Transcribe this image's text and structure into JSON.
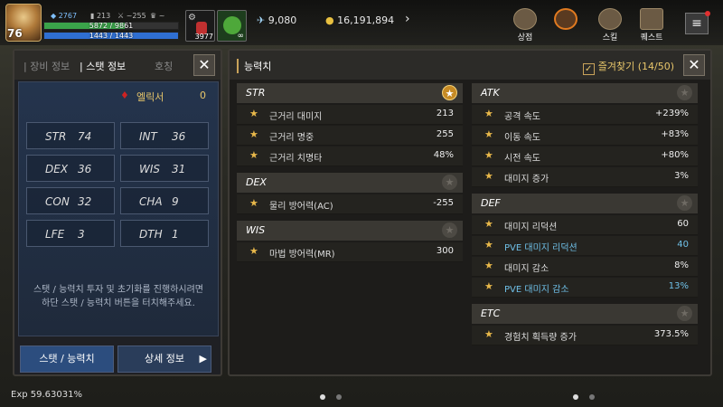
{
  "hud": {
    "level": "76",
    "gems": "2767",
    "stat1": "213",
    "stat2": "~255",
    "hp": "5872 / 9861",
    "mp": "1443 / 1443",
    "slot_count": "3977",
    "energy": "9,080",
    "gold": "16,191,894",
    "menu": [
      {
        "label": "상점"
      },
      {
        "label": ""
      },
      {
        "label": "스킬"
      },
      {
        "label": "퀘스트"
      }
    ]
  },
  "left": {
    "tabs": [
      "장비 정보",
      "스탯 정보",
      "호칭"
    ],
    "elixir_label": "엘릭서",
    "elixir_value": "0",
    "stats": [
      {
        "k": "STR",
        "v": "74"
      },
      {
        "k": "INT",
        "v": "36"
      },
      {
        "k": "DEX",
        "v": "36"
      },
      {
        "k": "WIS",
        "v": "31"
      },
      {
        "k": "CON",
        "v": "32"
      },
      {
        "k": "CHA",
        "v": "9"
      },
      {
        "k": "LFE",
        "v": "3"
      },
      {
        "k": "DTH",
        "v": "1"
      }
    ],
    "note": "스탯 / 능력치 투자 및 초기화를 진행하시려면 하단 스탯 / 능력치 버튼을 터치해주세요.",
    "btn_stat": "스탯 / 능력치",
    "btn_detail": "상세 정보"
  },
  "right": {
    "title": "능력치",
    "favorites": "즐겨찾기 (14/50)",
    "left_groups": [
      {
        "name": "STR",
        "starred": true,
        "rows": [
          {
            "name": "근거리 대미지",
            "value": "213"
          },
          {
            "name": "근거리 명중",
            "value": "255"
          },
          {
            "name": "근거리 치명타",
            "value": "48%"
          }
        ]
      },
      {
        "name": "DEX",
        "starred": false,
        "rows": [
          {
            "name": "물리 방어력(AC)",
            "value": "-255"
          }
        ]
      },
      {
        "name": "WIS",
        "starred": false,
        "rows": [
          {
            "name": "마법 방어력(MR)",
            "value": "300"
          }
        ]
      }
    ],
    "right_groups": [
      {
        "name": "ATK",
        "starred": false,
        "rows": [
          {
            "name": "공격 속도",
            "value": "+239%"
          },
          {
            "name": "이동 속도",
            "value": "+83%"
          },
          {
            "name": "시전 속도",
            "value": "+80%"
          },
          {
            "name": "대미지 증가",
            "value": "3%"
          }
        ]
      },
      {
        "name": "DEF",
        "starred": false,
        "rows": [
          {
            "name": "대미지 리덕션",
            "value": "60"
          },
          {
            "name": "PVE 대미지 리덕션",
            "value": "40",
            "blue": true
          },
          {
            "name": "대미지 감소",
            "value": "8%"
          },
          {
            "name": "PVE 대미지 감소",
            "value": "13%",
            "blue": true
          }
        ]
      },
      {
        "name": "ETC",
        "starred": false,
        "rows": [
          {
            "name": "경험치 획득량 증가",
            "value": "373.5%"
          }
        ]
      }
    ]
  },
  "exp": "Exp 59.63031%",
  "colors": {
    "accent": "#c9a35a",
    "blue_text": "#6fc0e8",
    "star": "#e8b84a"
  }
}
